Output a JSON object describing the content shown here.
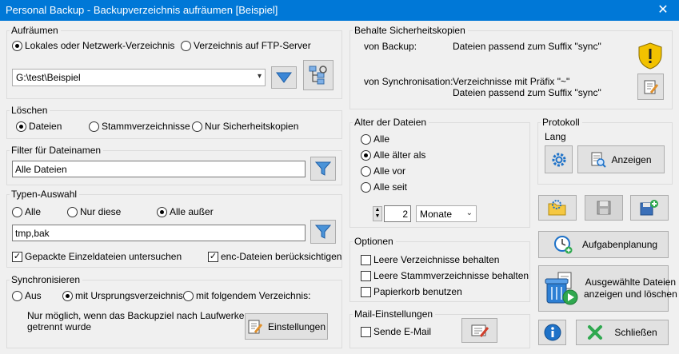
{
  "window": {
    "title": "Personal Backup - Backupverzeichnis aufräumen [Beispiel]",
    "close_glyph": "✕"
  },
  "aufraeumen": {
    "legend": "Aufräumen",
    "radio_local": "Lokales oder Netzwerk-Verzeichnis",
    "radio_ftp": "Verzeichnis auf FTP-Server",
    "path_value": "G:\\test\\Beispiel"
  },
  "loeschen": {
    "legend": "Löschen",
    "radio_files": "Dateien",
    "radio_root": "Stammverzeichnisse",
    "radio_backups": "Nur Sicherheitskopien"
  },
  "filter": {
    "legend": "Filter für Dateinamen",
    "value": "Alle Dateien"
  },
  "typen": {
    "legend": "Typen-Auswahl",
    "radio_all": "Alle",
    "radio_only": "Nur diese",
    "radio_except": "Alle außer",
    "value": "tmp,bak",
    "check_packed": "Gepackte Einzeldateien untersuchen",
    "check_enc": "enc-Dateien berücksichtigen"
  },
  "sync": {
    "legend": "Synchronisieren",
    "radio_off": "Aus",
    "radio_origin": "mit Ursprungsverzeichnis",
    "radio_following": "mit folgendem Verzeichnis:",
    "note_line1": "Nur möglich, wenn das Backupziel nach Laufwerken",
    "note_line2": "getrennt wurde",
    "settings_button": "Einstellungen"
  },
  "behalte": {
    "legend": "Behalte Sicherheitskopien",
    "from_backup_label": "von Backup:",
    "from_backup_value": "Dateien passend zum Suffix \"sync\"",
    "from_sync_label": "von Synchronisation:",
    "from_sync_value1": "Verzeichnisse mit Präfix \"~\"",
    "from_sync_value2": "Dateien passend zum Suffix \"sync\""
  },
  "alter": {
    "legend": "Alter der Dateien",
    "radio_all": "Alle",
    "radio_older": "Alle älter als",
    "radio_before": "Alle vor",
    "radio_since": "Alle seit",
    "amount": "2",
    "unit": "Monate"
  },
  "optionen": {
    "legend": "Optionen",
    "check_keep_empty": "Leere Verzeichnisse behalten",
    "check_keep_root": "Leere Stammverzeichnisse behalten",
    "check_recycle": "Papierkorb benutzen"
  },
  "mail": {
    "legend": "Mail-Einstellungen",
    "check_send": "Sende E-Mail"
  },
  "protokoll": {
    "legend": "Protokoll",
    "lang": "Lang",
    "show_button": "Anzeigen"
  },
  "actions": {
    "schedule_button": "Aufgabenplanung",
    "run_line1": "Ausgewählte Dateien",
    "run_line2": "anzeigen und löschen",
    "close_button": "Schließen"
  },
  "colors": {
    "titlebar": "#0078d7",
    "accent_blue": "#1e72c8",
    "green": "#2fa84f",
    "shield_yellow": "#f2c200"
  }
}
